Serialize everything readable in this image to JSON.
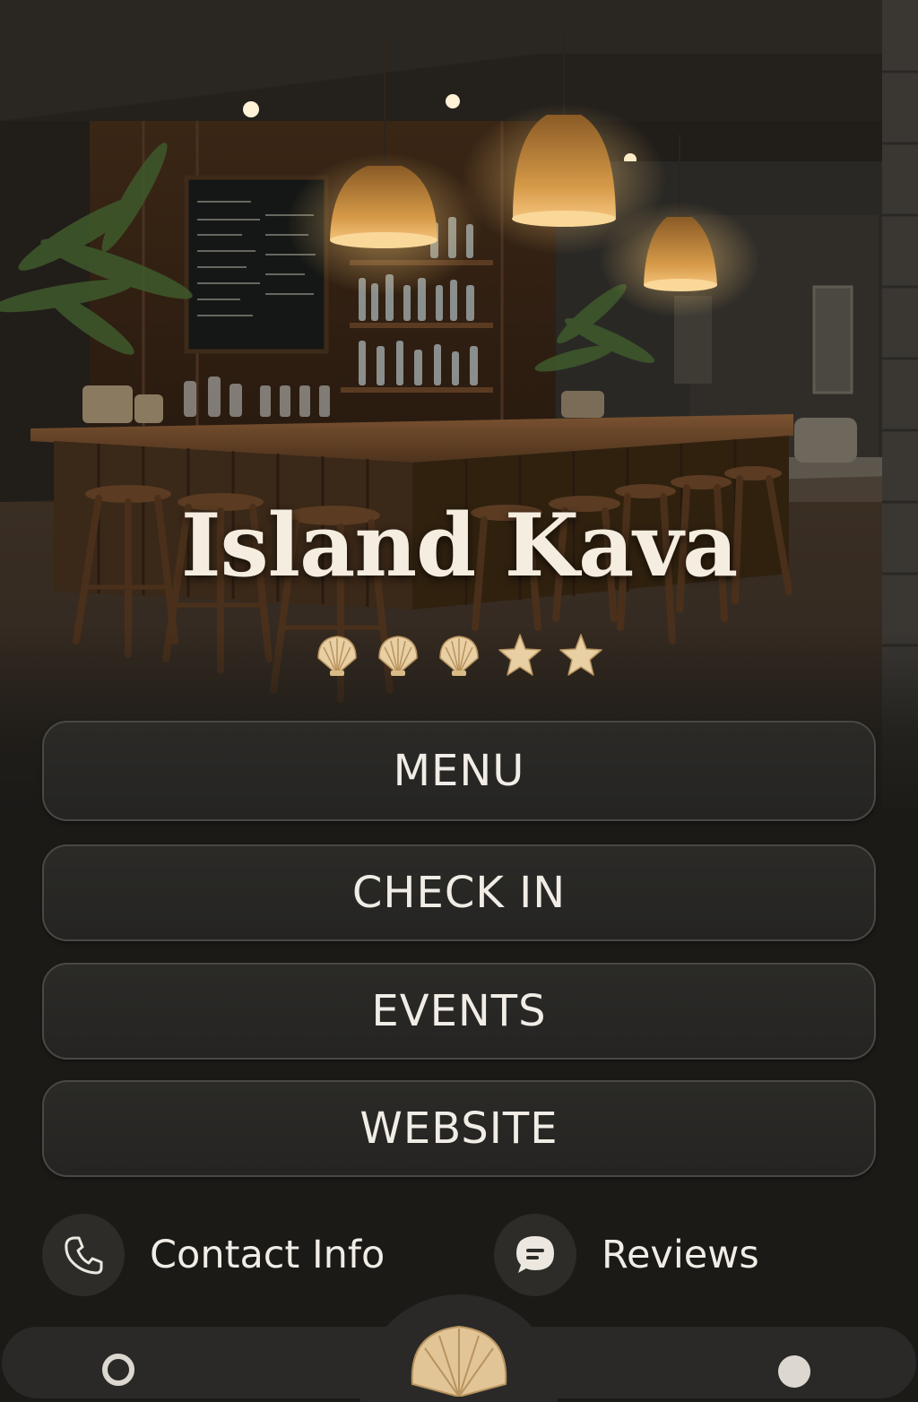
{
  "app": {
    "title": "Island Kava",
    "rating": [
      "shell-icon",
      "shell-icon",
      "shell-icon",
      "star-icon",
      "star-icon"
    ]
  },
  "actions": {
    "menu_label": "MENU",
    "checkin_label": "CHECK IN",
    "events_label": "EVENTS",
    "website_label": "WEBSITE"
  },
  "quick_links": {
    "contact_label": "Contact Info",
    "contact_icon": "phone-icon",
    "reviews_label": "Reviews",
    "reviews_icon": "chat-bubble-icon"
  },
  "bottom_nav": {
    "left_icon": "search-icon",
    "center_icon": "shell-icon",
    "right_icon": "profile-icon"
  },
  "colors": {
    "background": "#1b1a17",
    "button_bg": "#2a2927",
    "button_border": "#4a4844",
    "text": "#f1ede6",
    "accent_shell": "#e8cfa4"
  }
}
